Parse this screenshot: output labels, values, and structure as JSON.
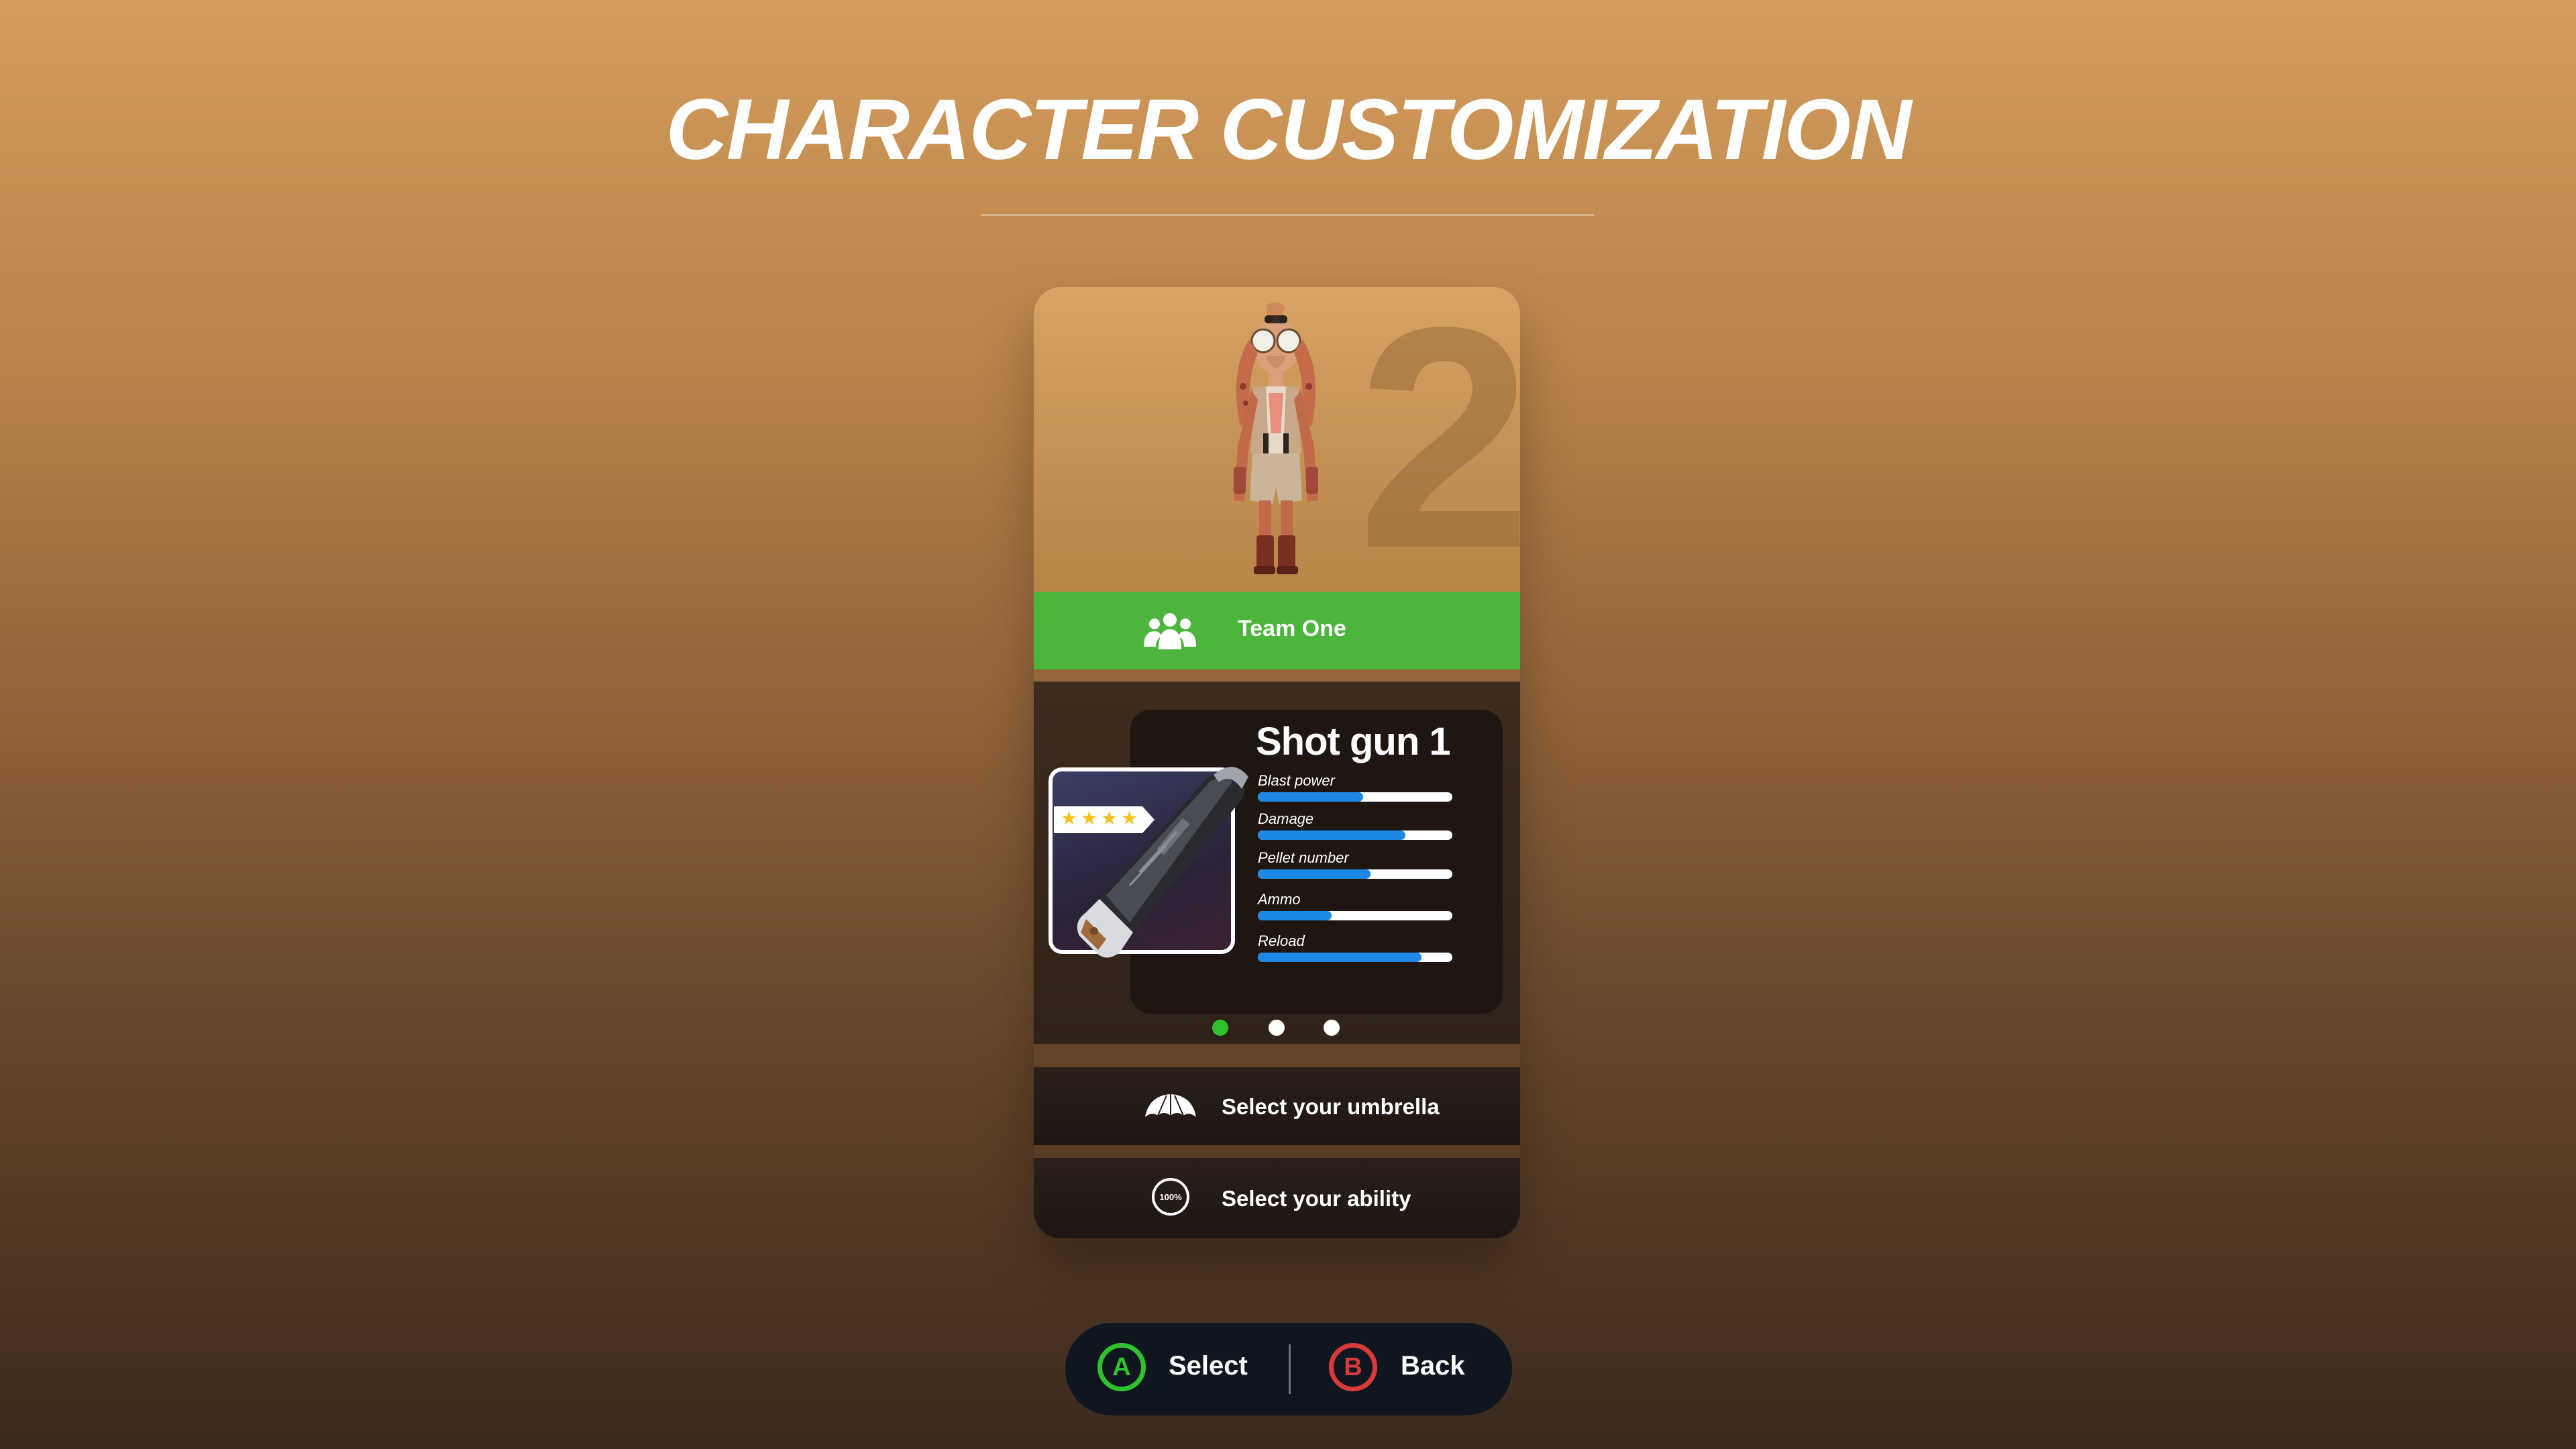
{
  "page": {
    "title": "CHARACTER CUSTOMIZATION"
  },
  "card": {
    "slot_number": "2",
    "team": {
      "label": "Team One",
      "icon": "team-icon",
      "color": "#4cb53c"
    },
    "weapon": {
      "name": "Shot gun 1",
      "rating_stars": 4,
      "stats": [
        {
          "label": "Blast power",
          "value": 0.54
        },
        {
          "label": "Damage",
          "value": 0.76
        },
        {
          "label": "Pellet number",
          "value": 0.58
        },
        {
          "label": "Ammo",
          "value": 0.38
        },
        {
          "label": "Reload",
          "value": 0.84
        }
      ],
      "stat_fill_color": "#1e88e5"
    },
    "carousel": {
      "pages": 3,
      "active_index": 0,
      "active_color": "#2ec22e"
    },
    "options": [
      {
        "label": "Select your umbrella",
        "icon": "umbrella-icon"
      },
      {
        "label": "Select your ability",
        "icon": "ability-icon",
        "icon_text": "100%"
      }
    ]
  },
  "controls": {
    "select": {
      "glyph": "A",
      "label": "Select",
      "color": "#2ec22e"
    },
    "back": {
      "glyph": "B",
      "label": "Back",
      "color": "#d83a3a"
    }
  }
}
